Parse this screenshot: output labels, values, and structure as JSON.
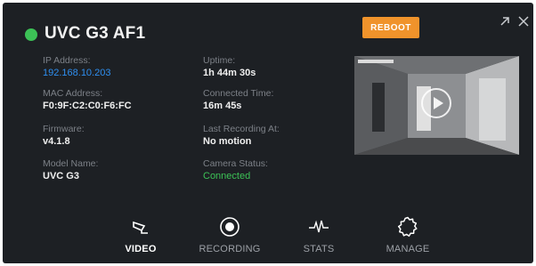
{
  "device": {
    "name": "UVC G3 AF1",
    "status": "online",
    "status_color": "#3cc156"
  },
  "actions": {
    "reboot_label": "REBOOT"
  },
  "window_controls": {
    "expand_icon": "expand-arrow-icon",
    "close_icon": "close-icon"
  },
  "info": {
    "ip_label": "IP Address:",
    "ip_value": "192.168.10.203",
    "mac_label": "MAC Address:",
    "mac_value": "F0:9F:C2:C0:F6:FC",
    "firmware_label": "Firmware:",
    "firmware_value": "v4.1.8",
    "model_label": "Model Name:",
    "model_value": "UVC G3",
    "uptime_label": "Uptime:",
    "uptime_value": "1h 44m 30s",
    "connected_label": "Connected Time:",
    "connected_value": "16m 45s",
    "last_rec_label": "Last Recording At:",
    "last_rec_value": "No motion",
    "camera_status_label": "Camera Status:",
    "camera_status_value": "Connected"
  },
  "tabs": [
    {
      "label": "VIDEO",
      "icon": "camera-icon",
      "active": true
    },
    {
      "label": "RECORDING",
      "icon": "record-icon",
      "active": false
    },
    {
      "label": "STATS",
      "icon": "pulse-icon",
      "active": false
    },
    {
      "label": "MANAGE",
      "icon": "gear-icon",
      "active": false
    }
  ],
  "colors": {
    "background": "#1d2024",
    "accent_orange": "#f0932b",
    "link_blue": "#2f8ff0",
    "success_green": "#3cc156"
  }
}
